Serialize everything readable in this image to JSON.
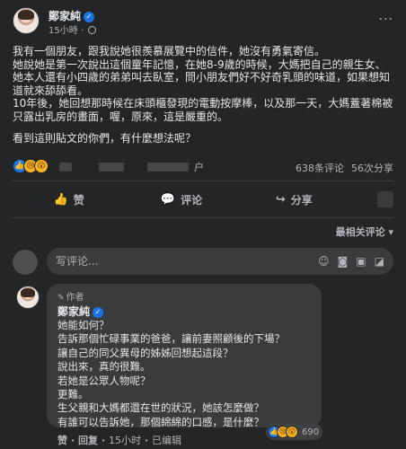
{
  "post": {
    "author": "鄭家純",
    "time": "15小時",
    "more": "···",
    "paragraphs": [
      "我有一個朋友，跟我說她很羨慕展覽中的信件，她沒有勇氣寄信。",
      "她說她是第一次說出這個童年記憶，在她8-9歲的時候，大媽把自己的親生女、她本人還有小四歲的弟弟叫去臥室，問小朋友們好不好奇乳頭的味道，如果想知道就來舔舔看。",
      "10年後，她回想那時候在床頭櫃發現的電動按摩棒，以及那一天，大媽蓋著棉被只露出乳房的畫面，喔，原來，這是嚴重的。",
      "看到這則貼文的你們，有什麼想法呢？"
    ],
    "reaction_icons": [
      "like",
      "sad",
      "wow"
    ],
    "names_suffix": "户",
    "comments_count": "638条评论",
    "shares_count": "56次分享"
  },
  "actions": {
    "like": "赞",
    "comment": "评论",
    "share": "分享"
  },
  "sort_label": "最相关评论 ▾",
  "composer": {
    "placeholder": "写评论..."
  },
  "comment": {
    "badge": "作者",
    "author": "鄭家純",
    "lines": [
      "她能如何？",
      "告訴那個忙碌事業的爸爸，讓前妻照顧後的下場？",
      "讓自己的同父異母的姊姊回想起這段？",
      "說出來，真的很難。",
      "若她是公眾人物呢？",
      "更難。",
      "生父親和大媽都還在世的狀況，她該怎麼做？",
      "有誰可以告訴她，那個綿綿的口感，是什麼？"
    ],
    "footer": {
      "like": "赞",
      "reply": "回复",
      "time": "15小时",
      "edited": "已编辑"
    },
    "reaction_count": "690"
  },
  "colors": {
    "background": "#242526",
    "bubble": "#3a3b3c",
    "text": "#e4e6eb",
    "secondary": "#b0b3b8",
    "verified": "#1b74e4"
  }
}
